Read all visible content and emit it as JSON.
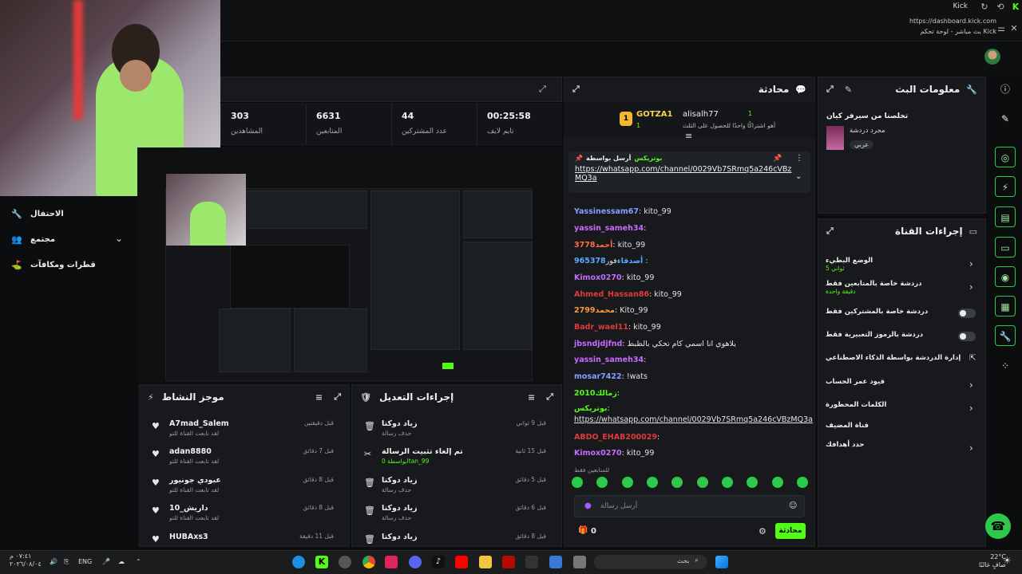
{
  "window": {
    "tab_title": "Kick",
    "url": "https://dashboard.kick.com",
    "page_title": "بث مباشر - لوحة تحكم Kick"
  },
  "colors": {
    "accent": "#53fc18",
    "panel": "#17191c",
    "bg": "#0b0d0f"
  },
  "left_nav": [
    {
      "icon": "wrench-icon",
      "label": "الاحتفال"
    },
    {
      "icon": "community-icon",
      "label": "مجتمع"
    },
    {
      "icon": "rewards-icon",
      "label": "قطرات ومكافآت"
    }
  ],
  "stats": [
    {
      "value": "303",
      "label": "المشاهدين"
    },
    {
      "value": "6631",
      "label": "المتابعين"
    },
    {
      "value": "44",
      "label": "عدد المشتركين"
    },
    {
      "value": "00:25:58",
      "label": "تايم لايف"
    }
  ],
  "chat": {
    "title": "محادثة",
    "leader_1": {
      "name": "GOTZA1",
      "count": "1"
    },
    "leader_2": {
      "name": "alisalh77",
      "count": "1",
      "note": "أهو اشتراكًا واحدًا للحصول على الثلث"
    },
    "pinned": {
      "by": "بواسطة",
      "author": "بوتريكس",
      "sender_label": "أرسل بواسطة",
      "link": "https://whatsapp.com/channel/0029Vb7SRmq5a246cVBz",
      "link2": "MQ3a"
    },
    "messages": [
      {
        "user": "Yassinessam67",
        "text": ": kito_99",
        "color": "#8b9cff"
      },
      {
        "user": "yassin_sameh34",
        "text": ":",
        "color": "#c86bff"
      },
      {
        "user": "3778",
        "text": ": kito_99",
        "user2": "أحمد",
        "color": "#ff6b4a"
      },
      {
        "user": "965378",
        "text": "فور :",
        "user2": "أصدقاء",
        "color": "#5aa9ff"
      },
      {
        "user": "Kimox0270",
        "text": ": kito_99",
        "color": "#c86bff"
      },
      {
        "user": "Ahmed_Hassan86",
        "text": ": kito_99",
        "color": "#e23a3a"
      },
      {
        "user": "2799",
        "text": ": Kito_99",
        "user2": "محمد",
        "color": "#ff9a3a"
      },
      {
        "user": "Badr_wael11",
        "text": ": kito_99",
        "color": "#e23a3a"
      },
      {
        "user": "jbsndjdjfnd",
        "text": ": يلاهوي انا اسمي كام تحكي بالظبط",
        "color": "#c86bff"
      },
      {
        "user": "yassin_sameh34",
        "text": ":",
        "color": "#c86bff"
      },
      {
        "user": "mosar7422",
        "text": ": !wats",
        "color": "#8b9cff"
      },
      {
        "user": "2010",
        "text": ":",
        "user2": "زمالك",
        "color": "#53fc18"
      },
      {
        "user": "بوتريكس",
        "text": ":",
        "color": "#53fc18"
      },
      {
        "user": "",
        "text": "https://whatsapp.com/channel/0029Vb7SRmq5a246cVBzMQ3a",
        "color": "#e4e4e4"
      },
      {
        "user": "ABDO_EHAB200029",
        "text": ":",
        "color": "#e23a3a"
      },
      {
        "user": "Kimox0270",
        "text": ": kito_99",
        "color": "#c86bff"
      }
    ],
    "followers_only": "للمتابعين فقط",
    "input_placeholder": "أرسل رسالة",
    "send_label": "محادثة",
    "points": "0"
  },
  "stream_info": {
    "title": "معلومات البث",
    "stream_title": "تخلصنا من سيرفر كيان",
    "category": "مجرد دردشة",
    "language": "عربي"
  },
  "channel_actions": {
    "title": "إجراءات القناة",
    "items": [
      {
        "label": "الوضع البطيء",
        "sub": "5 ثواني",
        "control": "chevron"
      },
      {
        "label": "دردشة خاصة بالمتابعين فقط",
        "sub": "دقيقة واحدة",
        "control": "chevron"
      },
      {
        "label": "دردشة خاصة بالمشتركين فقط",
        "sub": "",
        "control": "toggle"
      },
      {
        "label": "دردشة بالرموز التعبيرية فقط",
        "sub": "",
        "control": "toggle"
      },
      {
        "label": "إدارة الدردشة بواسطة الذكاء الاصطناعي",
        "sub": "",
        "control": "external"
      },
      {
        "label": "قيود عمر الحساب",
        "sub": "",
        "control": "chevron"
      },
      {
        "label": "الكلمات المحظورة",
        "sub": "",
        "control": "chevron"
      },
      {
        "label": "قناة المضيف",
        "sub": "",
        "control": "none"
      },
      {
        "label": "حدد أهدافك",
        "sub": "",
        "control": "chevron"
      }
    ]
  },
  "activity_feed": {
    "title": "موجز النشاط",
    "items": [
      {
        "name": "A7mad_Salem",
        "desc": "لقد تابعت القناة للتو",
        "time": "قبل دقيقتين"
      },
      {
        "name": "adan8880",
        "desc": "لقد تابعت القناة للتو",
        "time": "قبل 7 دقائق"
      },
      {
        "name": "عبودي جونيور",
        "desc": "لقد تابعت القناة للتو",
        "time": "قبل 8 دقائق"
      },
      {
        "name": "داريش_10",
        "desc": "لقد تابعت القناة للتو",
        "time": "قبل 8 دقائق"
      },
      {
        "name": "HUBAxs3",
        "desc": "",
        "time": "قبل 11 دقيقة"
      }
    ]
  },
  "mod_actions": {
    "title": "إجراءات التعديل",
    "items": [
      {
        "name": "زياد دوكتا",
        "desc": "حذف رسالة",
        "time": "قبل 9 ثواني",
        "icon": "trash-icon"
      },
      {
        "name": "تم إلغاء تثبيت الرسالة",
        "desc": "بواسطة 0ltan_99",
        "time": "قبل 15 ثانية",
        "icon": "unpin-icon"
      },
      {
        "name": "زياد دوكتا",
        "desc": "حذف رسالة",
        "time": "قبل 5 دقائق",
        "icon": "trash-icon"
      },
      {
        "name": "زياد دوكتا",
        "desc": "حذف رسالة",
        "time": "قبل 6 دقائق",
        "icon": "trash-icon"
      },
      {
        "name": "زياد دوكتا",
        "desc": "",
        "time": "قبل 8 دقائق",
        "icon": "trash-icon"
      }
    ]
  },
  "taskbar": {
    "time": "٠٧:٤١ م",
    "date": "٢٠٢٦/٠٨/٠٤",
    "lang": "ENG",
    "search": "بحث",
    "weather_temp": "22°C",
    "weather_desc": "صافٍ غالبًا"
  }
}
